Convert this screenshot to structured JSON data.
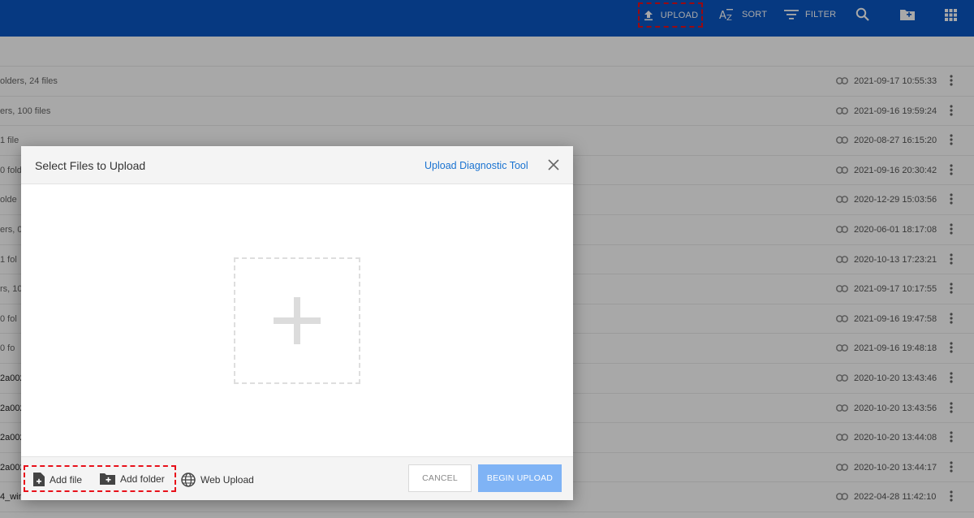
{
  "toolbar": {
    "upload_label": "UPLOAD",
    "sort_label": "SORT",
    "filter_label": "FILTER",
    "icons": [
      "upload-icon",
      "sort-az-icon",
      "filter-icon",
      "search-icon",
      "new-folder-icon",
      "grid-view-icon"
    ]
  },
  "file_rows": [
    {
      "name": "olders, 24 files",
      "date": "2021-09-17 10:55:33"
    },
    {
      "name": "ers, 100 files",
      "date": "2021-09-16 19:59:24"
    },
    {
      "name": "1 file",
      "date": "2020-08-27 16:15:20"
    },
    {
      "name": "0 fold",
      "date": "2021-09-16 20:30:42"
    },
    {
      "name": "olde",
      "date": "2020-12-29 15:03:56"
    },
    {
      "name": "ers, 0",
      "date": "2020-06-01 18:17:08"
    },
    {
      "name": "1 fol",
      "date": "2020-10-13 17:23:21"
    },
    {
      "name": "rs, 10",
      "date": "2021-09-17 10:17:55"
    },
    {
      "name": "0 fol",
      "date": "2021-09-16 19:47:58"
    },
    {
      "name": "0 fo",
      "date": "2021-09-16 19:48:18"
    },
    {
      "name": "2a002",
      "date": "2020-10-20 13:43:46"
    },
    {
      "name": "2a002",
      "date": "2020-10-20 13:43:56"
    },
    {
      "name": "2a002",
      "date": "2020-10-20 13:44:08"
    },
    {
      "name": "2a002",
      "date": "2020-10-20 13:44:17"
    },
    {
      "name": "4_win",
      "date": "2022-04-28 11:42:10"
    }
  ],
  "dialog": {
    "title": "Select Files to Upload",
    "diagnostic_link": "Upload Diagnostic Tool",
    "add_file_label": "Add file",
    "add_folder_label": "Add folder",
    "web_upload_label": "Web Upload",
    "cancel_label": "CANCEL",
    "begin_upload_label": "BEGIN UPLOAD"
  },
  "colors": {
    "topbar": "#0a57c4",
    "link": "#1a73d1",
    "begin_button": "#7fb3f5",
    "highlight_dash": "#e8101a"
  }
}
